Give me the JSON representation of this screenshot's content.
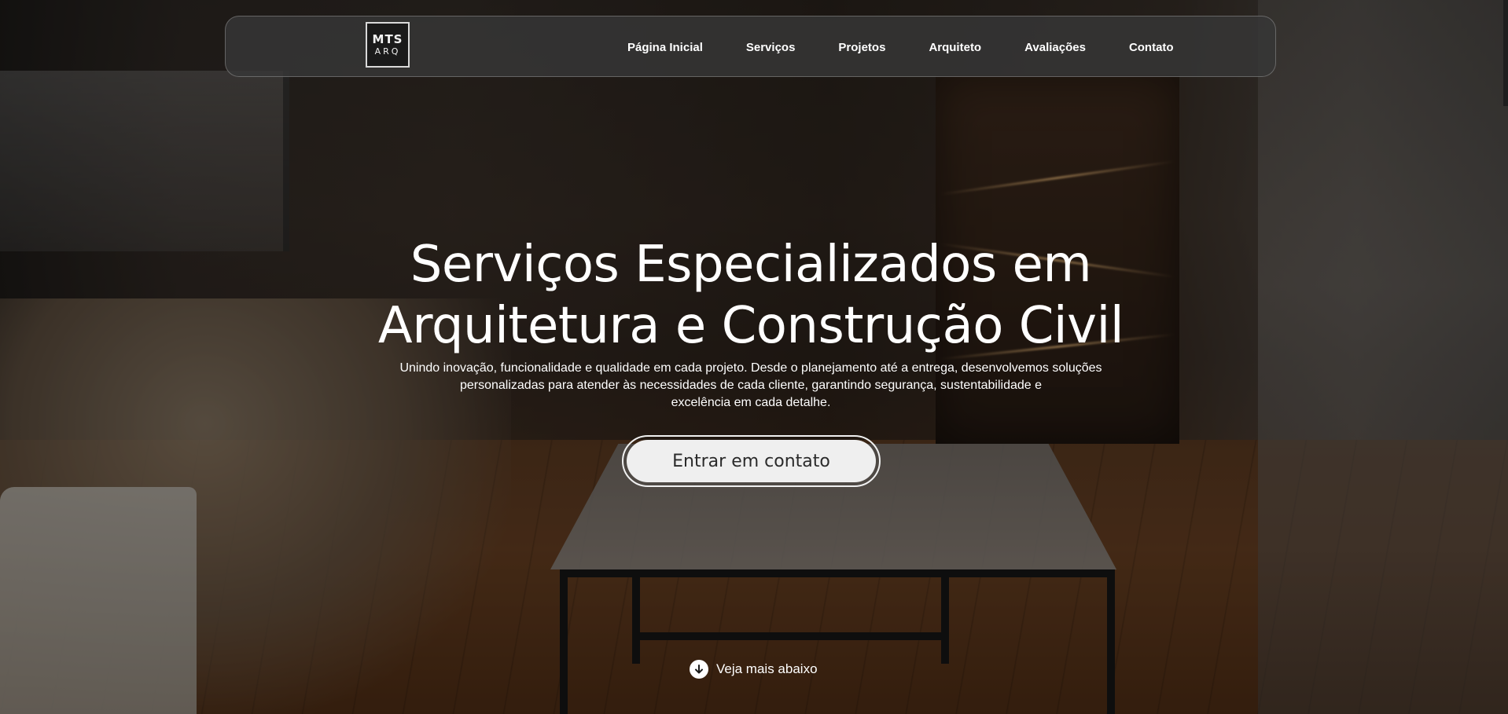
{
  "logo": {
    "line1": "MTS",
    "line2": "ARQ"
  },
  "nav": {
    "items": [
      {
        "label": "Página Inicial"
      },
      {
        "label": "Serviços"
      },
      {
        "label": "Projetos"
      },
      {
        "label": "Arquiteto"
      },
      {
        "label": "Avaliações"
      },
      {
        "label": "Contato"
      }
    ]
  },
  "hero": {
    "headline_line1": "Serviços Especializados em",
    "headline_line2": "Arquitetura e Construção Civil",
    "subtext_line1": "Unindo inovação, funcionalidade e qualidade em cada projeto. Desde o planejamento até a entrega, desenvolvemos soluções",
    "subtext_line2": "personalizadas para atender às necessidades de cada cliente, garantindo segurança, sustentabilidade e",
    "subtext_line3": "excelência em cada detalhe.",
    "cta_label": "Entrar em contato",
    "scroll_label": "Veja mais abaixo",
    "scroll_icon": "arrow-down-circle-icon"
  },
  "colors": {
    "overlay": "#000000",
    "navbar_bg": "#373737",
    "text": "#ffffff",
    "cta_bg": "#efefef",
    "cta_text": "#2a2a2a"
  }
}
